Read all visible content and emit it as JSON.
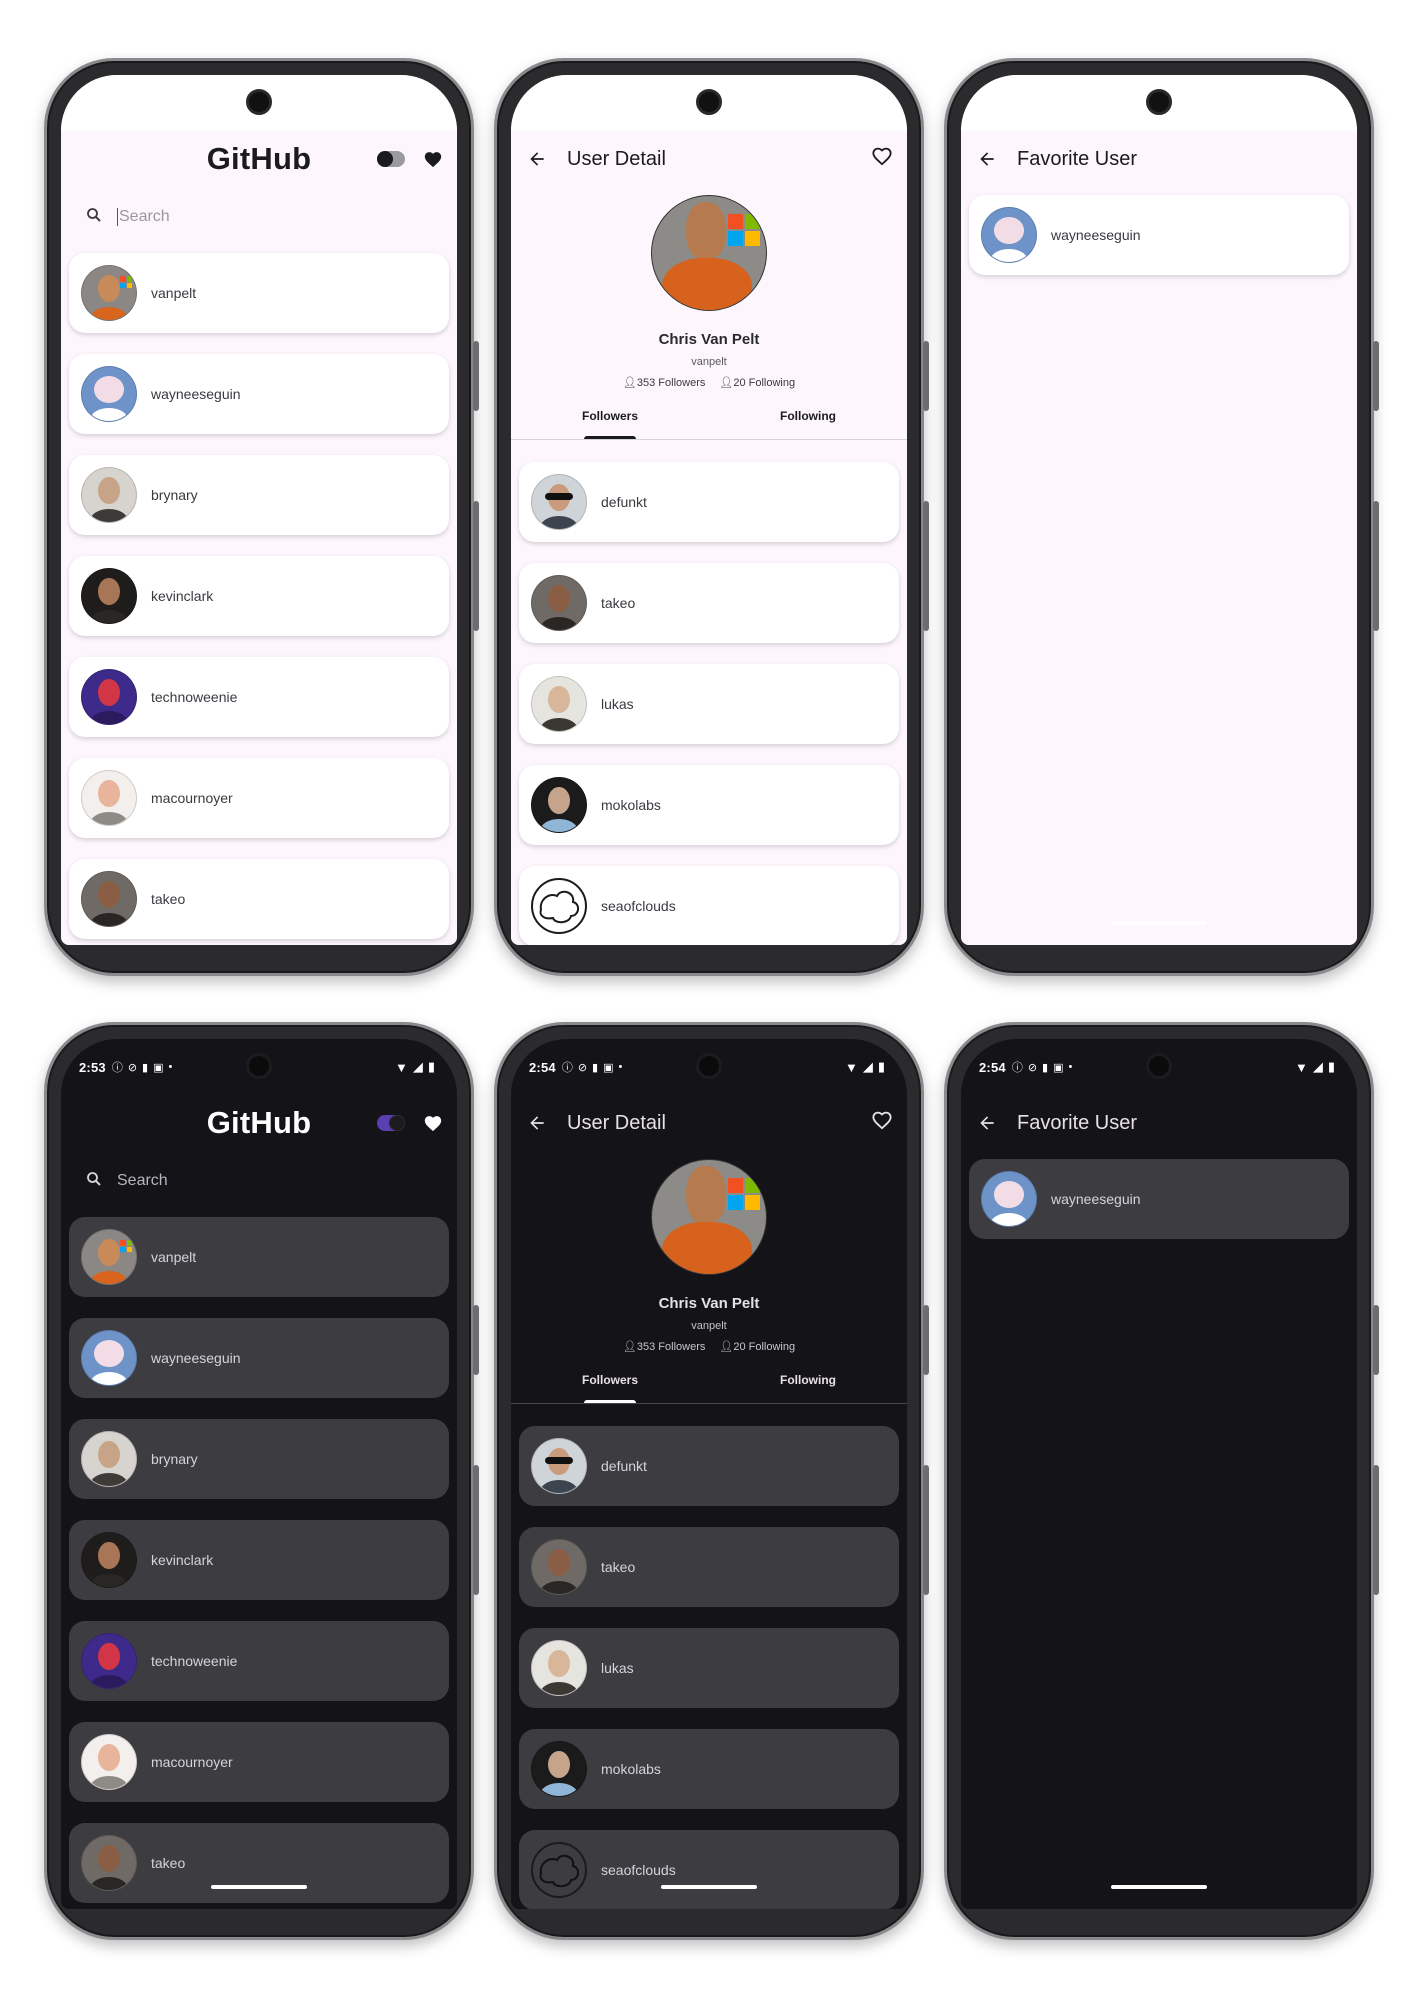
{
  "main_screen": {
    "title": "GitHub",
    "search_placeholder": "Search",
    "users": [
      "vanpelt",
      "wayneeseguin",
      "brynary",
      "kevinclark",
      "technoweenie",
      "macournoyer",
      "takeo"
    ]
  },
  "detail_screen": {
    "title": "User Detail",
    "name": "Chris Van Pelt",
    "login": "vanpelt",
    "followers_label": "353 Followers",
    "following_label": "20 Following",
    "tabs": [
      "Followers",
      "Following"
    ],
    "followers": [
      "defunkt",
      "takeo",
      "lukas",
      "mokolabs",
      "seaofclouds"
    ]
  },
  "favorite_screen": {
    "title": "Favorite User",
    "users": [
      "wayneeseguin"
    ]
  },
  "status_bar": {
    "main_time": "2:53",
    "detail_time": "2:54",
    "favorite_time": "2:54"
  },
  "icons": {
    "back": "arrow-back-icon",
    "favorite": "heart-icon",
    "search": "search-icon",
    "theme": "theme-toggle"
  },
  "theme_colors": {
    "light_bg": "#fdf7fd",
    "dark_bg": "#141317",
    "dark_card": "#3d3c40",
    "accent": "#5b3fb0"
  }
}
